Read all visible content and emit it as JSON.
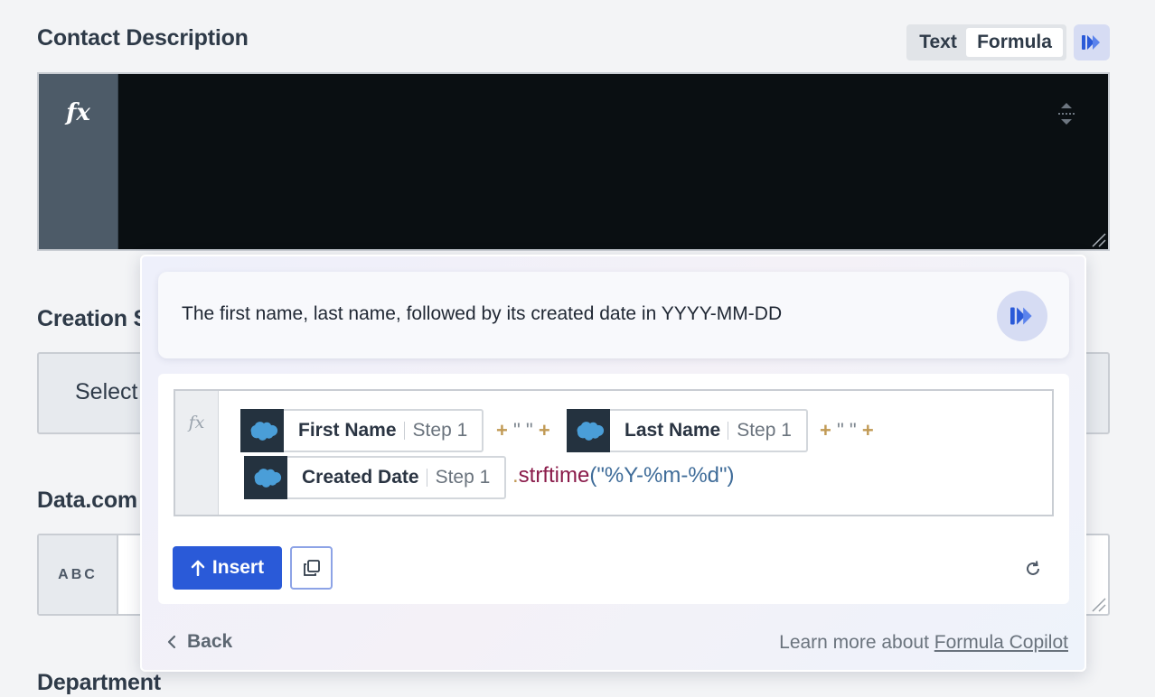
{
  "fields": {
    "contact_description": "Contact Description",
    "creation_source": "Creation S",
    "data_com": "Data.com",
    "department": "Department"
  },
  "mode_toggle": {
    "text": "Text",
    "formula": "Formula",
    "selected": "Formula"
  },
  "editor": {
    "fx_label": "fx"
  },
  "select_box": {
    "text": "Select"
  },
  "abc_field": {
    "gutter_label": "ABC"
  },
  "copilot": {
    "prompt": "The first name, last name, followed by its created date in YYYY-MM-DD",
    "result": {
      "fx_label": "fx",
      "tokens": [
        {
          "name": "First Name",
          "step": "Step 1",
          "logo": "salesforce"
        },
        {
          "name": "Last Name",
          "step": "Step 1",
          "logo": "salesforce"
        },
        {
          "name": "Created Date",
          "step": "Step 1",
          "logo": "salesforce"
        }
      ],
      "operators": {
        "plus": "+",
        "quote": "\" \""
      },
      "tail": {
        "dot": ".",
        "fn": "strftime",
        "open": "(",
        "str": "\"%Y-%m-%d\"",
        "close": ")"
      }
    },
    "insert_label": "Insert",
    "back_label": "Back",
    "learn_more_prefix": "Learn more about",
    "learn_more_link": "Formula Copilot"
  },
  "colors": {
    "accent": "#2a5ad8",
    "editor_bg": "#0a0f12",
    "gutter": "#4d5b68"
  }
}
